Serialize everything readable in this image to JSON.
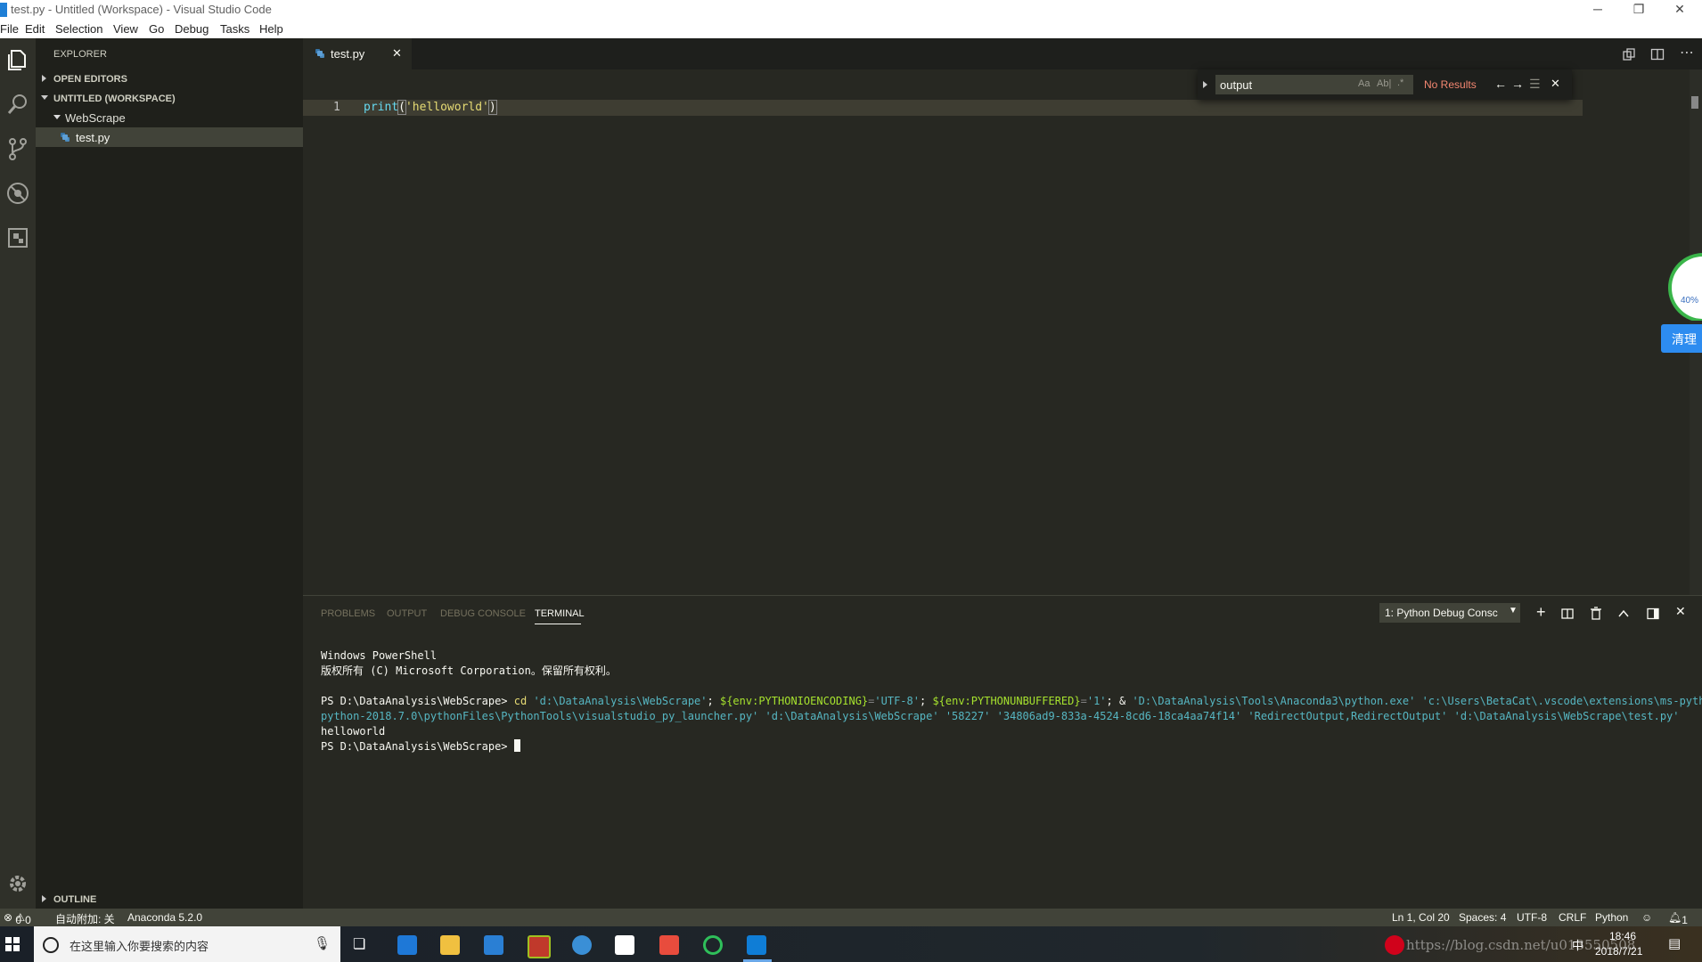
{
  "window": {
    "title": "test.py - Untitled (Workspace) - Visual Studio Code",
    "minimize": "─",
    "restore": "❐",
    "close": "✕"
  },
  "menu": [
    "File",
    "Edit",
    "Selection",
    "View",
    "Go",
    "Debug",
    "Tasks",
    "Help"
  ],
  "sidebar": {
    "title": "EXPLORER",
    "open_editors": "OPEN EDITORS",
    "workspace": "UNTITLED (WORKSPACE)",
    "folder": "WebScrape",
    "file": "test.py",
    "outline": "OUTLINE"
  },
  "editor": {
    "tab_label": "test.py",
    "line_number": "1",
    "code": {
      "func": "print",
      "open": "(",
      "string": "'helloworld'",
      "close": ")"
    }
  },
  "find": {
    "value": "output",
    "opt_case": "Aa",
    "opt_word": "Ab|",
    "opt_regex": ".*",
    "result": "No Results",
    "accent_color": "#f48771"
  },
  "panel": {
    "tabs": [
      "PROBLEMS",
      "OUTPUT",
      "DEBUG CONSOLE",
      "TERMINAL"
    ],
    "terminal_select": "1: Python Debug Consc",
    "lines": {
      "l1": "Windows PowerShell",
      "l2": "版权所有 (C) Microsoft Corporation。保留所有权利。",
      "prompt": "PS D:\\DataAnalysis\\WebScrape>",
      "cmd_cd": "cd",
      "cmd_path": "'d:\\DataAnalysis\\WebScrape'",
      "semi1": ";",
      "env1": "${env:PYTHONIOENCODING}",
      "eq1": "=",
      "val1": "'UTF-8'",
      "semi2": ";",
      "env2": "${env:PYTHONUNBUFFERED}",
      "eq2": "=",
      "val2": "'1'",
      "amp": "; &",
      "exe": "'D:\\DataAnalysis\\Tools\\Anaconda3\\python.exe'",
      "launcher_a": "'c:\\Users\\BetaCat\\.vscode\\extensions\\ms-python.",
      "launcher_b": "python-2018.7.0\\pythonFiles\\PythonTools\\visualstudio_py_launcher.py'",
      "arg1": "'d:\\DataAnalysis\\WebScrape'",
      "arg2": "'58227'",
      "arg3": "'34806ad9-833a-4524-8cd6-18ca4aa74f14'",
      "arg4": "'RedirectOutput,RedirectOutput'",
      "arg5": "'d:\\DataAnalysis\\WebScrape\\test.py'",
      "output": "helloworld",
      "prompt2": "PS D:\\DataAnalysis\\WebScrape>"
    }
  },
  "overlay": {
    "percent": "40%",
    "clean_button": "清理"
  },
  "status": {
    "errors": "0",
    "warnings": "0",
    "attach": "自动附加: 关",
    "interpreter": "Anaconda 5.2.0",
    "position": "Ln 1, Col 20",
    "spaces": "Spaces: 4",
    "encoding": "UTF-8",
    "eol": "CRLF",
    "language": "Python",
    "bell_count": "1"
  },
  "taskbar": {
    "search_placeholder": "在这里输入你要搜索的内容",
    "watermark": "https://blog.csdn.net/u013550508",
    "ime": "中",
    "time": "18:46",
    "date": "2018/7/21"
  },
  "colors": {
    "bg": "#272822",
    "sidebar": "#1f201b",
    "keyword": "#66d9ef",
    "string": "#e6db74",
    "env": "#a6e22e",
    "term_blue": "#56b6c2"
  }
}
